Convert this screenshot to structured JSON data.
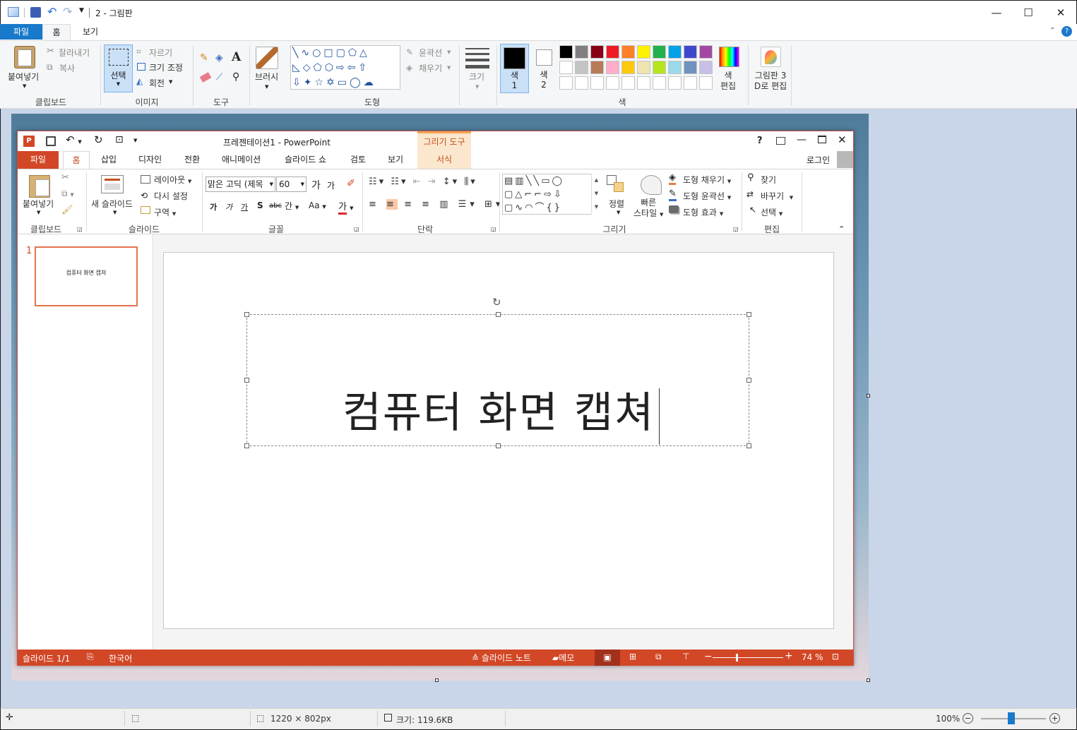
{
  "paint": {
    "title": "2 - 그림판",
    "tabs": [
      "파일",
      "홈",
      "보기"
    ],
    "clipboard": {
      "paste": "붙여넣기",
      "cut": "잘라내기",
      "copy": "복사",
      "label": "클립보드"
    },
    "image": {
      "select": "선택",
      "crop": "자르기",
      "resize": "크기 조정",
      "rotate": "회전",
      "label": "이미지"
    },
    "tools": {
      "label": "도구"
    },
    "brush": "브러시",
    "shapes": {
      "outline": "윤곽선",
      "fill": "채우기",
      "label": "도형"
    },
    "size": "크기",
    "color1": [
      "색",
      "1"
    ],
    "color2": [
      "색",
      "2"
    ],
    "edit_colors": [
      "색",
      "편집"
    ],
    "colors_label": "색",
    "paint3d": [
      "그림판 3",
      "D로 편집"
    ],
    "palette_row1": [
      "#000000",
      "#7f7f7f",
      "#880015",
      "#ed1c24",
      "#ff7f27",
      "#fff200",
      "#22b14c",
      "#00a2e8",
      "#3f48cc",
      "#a349a4"
    ],
    "palette_row2": [
      "#ffffff",
      "#c3c3c3",
      "#b97a57",
      "#ffaec9",
      "#ffc90e",
      "#efe4b0",
      "#b5e61d",
      "#99d9ea",
      "#7092be",
      "#c8bfe7"
    ],
    "status": {
      "dimensions": "1220 × 802px",
      "size": "크기: 119.6KB",
      "zoom": "100%"
    }
  },
  "ppt": {
    "title": "프레젠테이션1 - PowerPoint",
    "drawing_tools": "그리기 도구",
    "help": "?",
    "tabs": [
      "파일",
      "홈",
      "삽입",
      "디자인",
      "전환",
      "애니메이션",
      "슬라이드 쇼",
      "검토",
      "보기",
      "서식"
    ],
    "login": "로그인",
    "clipboard": {
      "paste": "붙여넣기",
      "label": "클립보드"
    },
    "slides": {
      "new": "새 슬라이드",
      "layout": "레이아웃",
      "reset": "다시 설정",
      "section": "구역",
      "label": "슬라이드"
    },
    "font": {
      "name": "맑은 고딕 (제목",
      "size": "60",
      "grow": "가",
      "shrink": "가",
      "bold": "가",
      "italic": "가",
      "underline": "가",
      "shadow": "S",
      "strike": "abc",
      "spacing": "간",
      "case": "Aa",
      "color": "가",
      "label": "글꼴"
    },
    "paragraph": {
      "label": "단락"
    },
    "drawing": {
      "arrange": "정렬",
      "quick_styles": [
        "빠른",
        "스타일"
      ],
      "fill": "도형 채우기",
      "outline": "도형 윤곽선",
      "effects": "도형 효과",
      "label": "그리기"
    },
    "editing": {
      "find": "찾기",
      "replace": "바꾸기",
      "select": "선택",
      "label": "편집"
    },
    "thumb_number": "1",
    "thumb_text": "컴퓨터 화면 캡쳐",
    "slide_text": "컴퓨터 화면 캡쳐",
    "status": {
      "slide": "슬라이드 1/1",
      "lang": "한국어",
      "notes": "슬라이드 노트",
      "comments": "메모",
      "zoom": "74 %"
    }
  }
}
